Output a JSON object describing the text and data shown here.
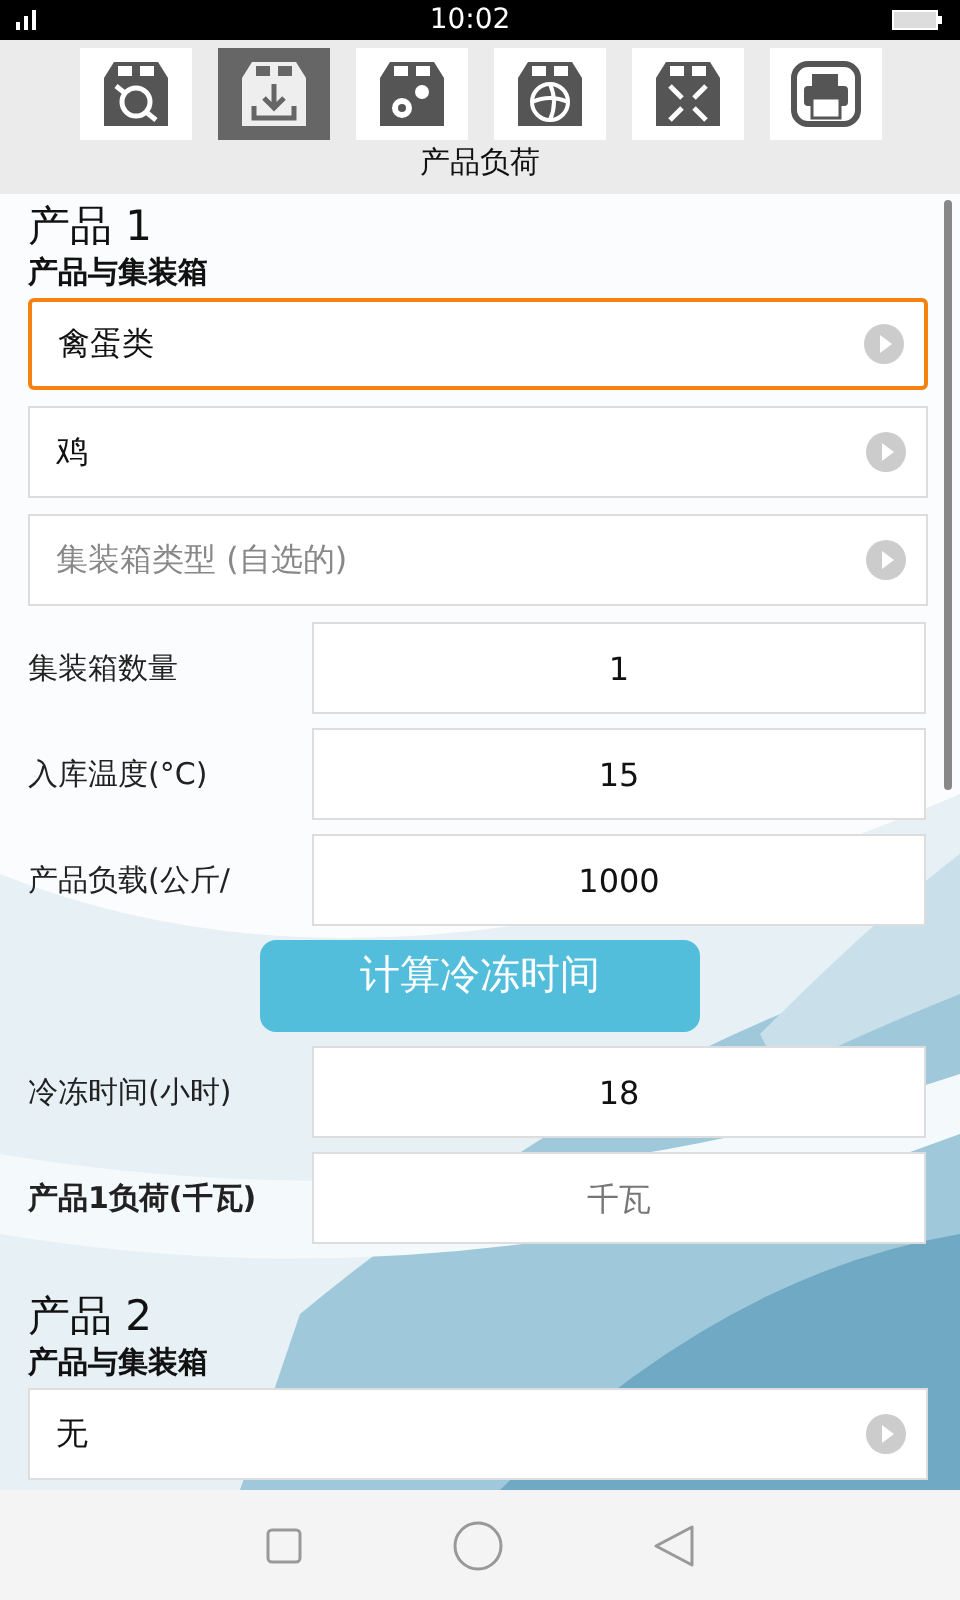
{
  "status_bar": {
    "time": "10:02"
  },
  "toolbar": {
    "tabs": [
      {
        "kind": "sync",
        "selected": false
      },
      {
        "kind": "download",
        "selected": true
      },
      {
        "kind": "gears",
        "selected": false
      },
      {
        "kind": "fan",
        "selected": false
      },
      {
        "kind": "compress",
        "selected": false
      },
      {
        "kind": "printer",
        "selected": false
      }
    ],
    "title": "产品负荷"
  },
  "products": [
    {
      "heading": "产品 1",
      "section_label": "产品与集装箱",
      "items": [
        {
          "kind": "select",
          "value": "禽蛋类",
          "focused": true
        },
        {
          "kind": "select",
          "value": "鸡",
          "focused": false
        },
        {
          "kind": "select",
          "placeholder": "集装箱类型 (自选的)",
          "focused": false
        },
        {
          "kind": "field",
          "label": "集装箱数量",
          "value": "1",
          "bold": false
        },
        {
          "kind": "field",
          "label": "入库温度(°C)",
          "value": "15",
          "bold": false
        },
        {
          "kind": "field",
          "label": "产品负载(公斤/",
          "value": "1000",
          "bold": false
        },
        {
          "kind": "button",
          "label": "计算冷冻时间"
        },
        {
          "kind": "field",
          "label": "冷冻时间(小时)",
          "value": "18",
          "bold": false
        },
        {
          "kind": "field",
          "label": "产品1负荷(千瓦)",
          "placeholder": "千瓦",
          "bold": true
        }
      ]
    },
    {
      "heading": "产品 2",
      "section_label": "产品与集装箱",
      "items": [
        {
          "kind": "select",
          "value": "无",
          "focused": false
        }
      ]
    }
  ]
}
